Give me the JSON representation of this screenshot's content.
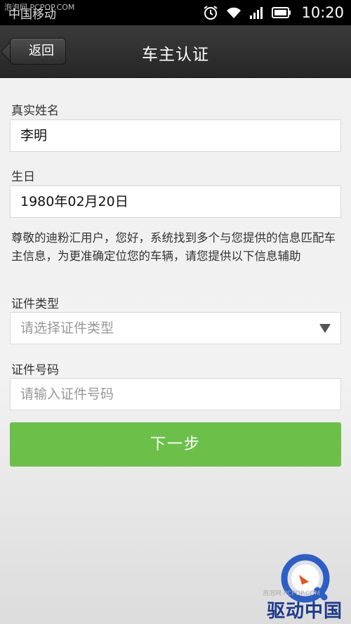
{
  "status_bar": {
    "carrier": "中国移动",
    "watermark": "泡泡网 PCPOP.COM",
    "time": "10:20"
  },
  "header": {
    "back_label": "返回",
    "title": "车主认证"
  },
  "form": {
    "name_label": "真实姓名",
    "name_value": "李明",
    "birthday_label": "生日",
    "birthday_value": "1980年02月20日",
    "notice": "尊敬的迪粉汇用户，您好，系统找到多个与您提供的信息匹配车主信息，为更准确定位您的车辆，请您提供以下信息辅助",
    "id_type_label": "证件类型",
    "id_type_placeholder": "请选择证件类型",
    "id_number_label": "证件号码",
    "id_number_placeholder": "请输入证件号码",
    "next_label": "下一步"
  },
  "watermark": {
    "brand": "驱动中国",
    "small_text": "泡泡网 PCPOP.COM"
  },
  "colors": {
    "accent_green": "#6cc04a",
    "header_dark": "#2e2e2e"
  },
  "icons": [
    "alarm-icon",
    "wifi-icon",
    "signal-icon",
    "battery-icon",
    "dropdown-arrow-icon"
  ]
}
